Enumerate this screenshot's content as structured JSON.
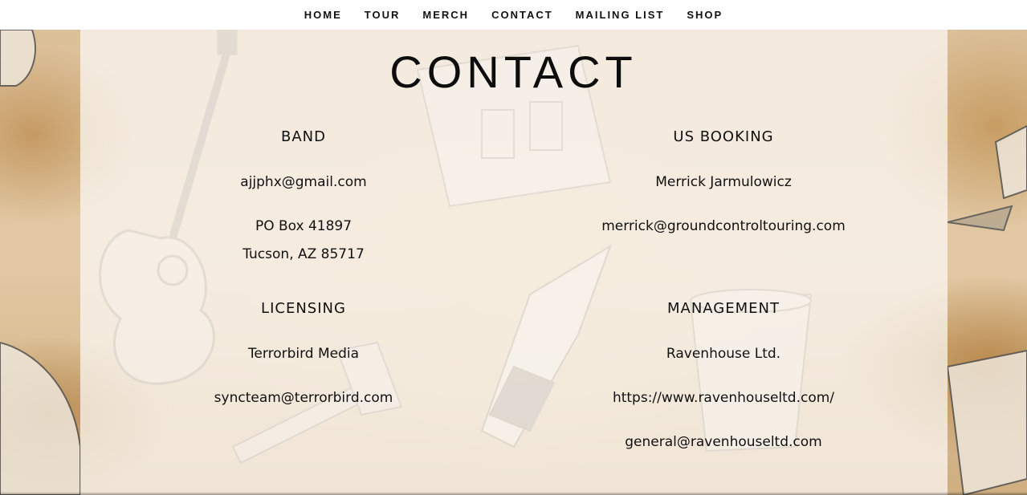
{
  "nav": {
    "items": [
      {
        "label": "HOME"
      },
      {
        "label": "TOUR"
      },
      {
        "label": "MERCH"
      },
      {
        "label": "CONTACT"
      },
      {
        "label": "MAILING LIST"
      },
      {
        "label": "SHOP"
      }
    ]
  },
  "page": {
    "title": "CONTACT"
  },
  "band": {
    "heading": "BAND",
    "email": "ajjphx@gmail.com",
    "address_line1": "PO Box 41897",
    "address_line2": "Tucson, AZ 85717"
  },
  "us_booking": {
    "heading": "US BOOKING",
    "name": "Merrick Jarmulowicz",
    "email": "merrick@groundcontroltouring.com"
  },
  "licensing": {
    "heading": "LICENSING",
    "company": "Terrorbird Media",
    "email": "syncteam@terrorbird.com"
  },
  "management": {
    "heading": "MANAGEMENT",
    "company": "Ravenhouse Ltd.",
    "url": "https://www.ravenhouseltd.com/",
    "email": "general@ravenhouseltd.com"
  },
  "colors": {
    "text": "#111111",
    "panel": "#fcfaf6",
    "background_sepia": "#dcc09a"
  }
}
